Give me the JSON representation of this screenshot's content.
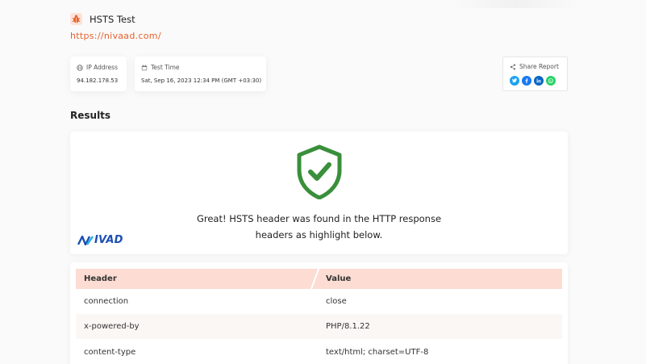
{
  "header": {
    "title": "HSTS Test",
    "url": "https://nivaad.com/"
  },
  "info": {
    "ip_label": "IP Address",
    "ip_value": "94.182.178.53",
    "time_label": "Test Time",
    "time_value": "Sat, Sep 16, 2023 12:34 PM (GMT +03:30)"
  },
  "share": {
    "label": "Share Report",
    "icons": [
      "twitter-icon",
      "facebook-icon",
      "linkedin-icon",
      "whatsapp-icon"
    ]
  },
  "results": {
    "heading": "Results",
    "message_line1": "Great! HSTS header was found in the HTTP response",
    "message_line2": "headers as highlight below.",
    "brand": "IVAD"
  },
  "table": {
    "columns": [
      "Header",
      "Value"
    ],
    "rows": [
      {
        "header": "connection",
        "value": "close"
      },
      {
        "header": "x-powered-by",
        "value": "PHP/8.1.22"
      },
      {
        "header": "content-type",
        "value": "text/html; charset=UTF-8"
      }
    ]
  },
  "colors": {
    "accent": "#e8612c",
    "success": "#3a8f3b",
    "table_header": "#fcdcd3",
    "brand": "#1b4fb3"
  }
}
